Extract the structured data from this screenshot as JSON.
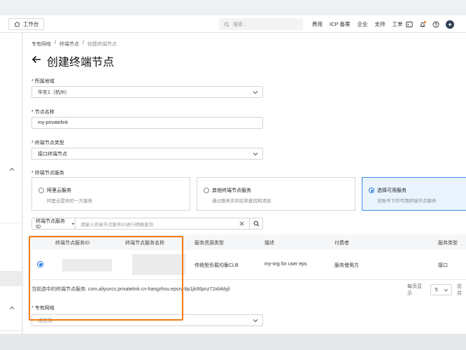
{
  "topbar": {
    "workbench_label": "工作台",
    "search_placeholder": "搜索...",
    "nav": [
      "费用",
      "ICP 备案",
      "企业",
      "支持",
      "工单"
    ]
  },
  "breadcrumb": [
    "专有网络",
    "终端节点",
    "创建终端节点"
  ],
  "page_title": "创建终端节点",
  "form": {
    "region_label": "所属地域",
    "region_value": "华东1（杭州）",
    "name_label": "节点名称",
    "name_value": "my-privatelink",
    "type_label": "终端节点类型",
    "type_value": "接口终端节点",
    "service_label": "终端节点服务",
    "vpc_label": "专有网络",
    "vpc_placeholder": "请选择"
  },
  "service_options": [
    {
      "title": "阿里云服务",
      "desc": "阿里云提供的一方服务",
      "selected": false
    },
    {
      "title": "其他终端节点服务",
      "desc": "通过服务实例名称查找和添加",
      "selected": false
    },
    {
      "title": "选择可用服务",
      "desc": "该账号下的可用终端节点服务",
      "selected": true
    }
  ],
  "filter": {
    "field_label": "终端节点服务ID",
    "placeholder": "请输入终端节点服务ID进行精确查询"
  },
  "table": {
    "headers": [
      "终端节点服务ID",
      "终端节点服务名称",
      "服务资源类型",
      "描述",
      "付费者",
      "服务类型"
    ],
    "row": {
      "resource_type": "传统型负载均衡CLB",
      "description": "my-org for user eps",
      "payer": "服务使用方",
      "service_type": "接口"
    }
  },
  "current_selection": "当前选中的终端节点服务: com.aliyuncs.privatelink.cn-hangzhou.epsrv-bp1jk66pnz72xli4dyjl",
  "pager": {
    "per_page_label": "每页显示",
    "per_page_value": "5",
    "total_label": "总共"
  },
  "colors": {
    "accent": "#1f6fe0",
    "highlight_box": "#f07a14",
    "selected_card_bg": "#eaf4ff"
  }
}
